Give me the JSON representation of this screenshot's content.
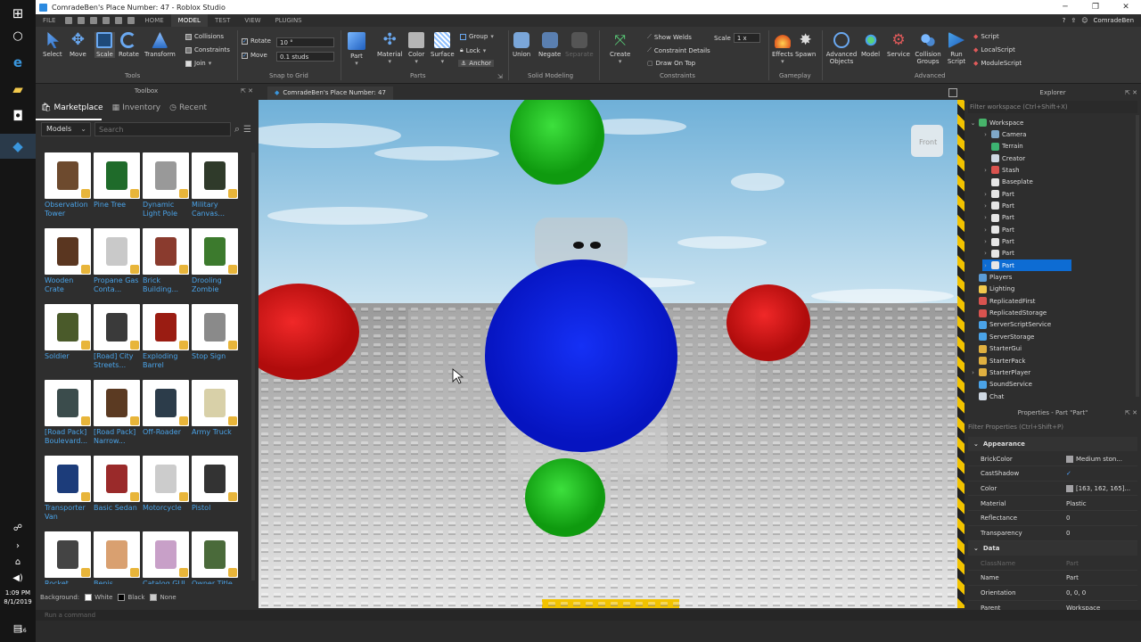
{
  "window": {
    "title": "ComradeBen's Place Number: 47 - Roblox Studio"
  },
  "menu": {
    "file": "FILE",
    "tabs": [
      "HOME",
      "MODEL",
      "TEST",
      "VIEW",
      "PLUGINS"
    ],
    "active_tab": "MODEL",
    "username": "ComradeBen"
  },
  "ribbon": {
    "tools": {
      "select": "Select",
      "move": "Move",
      "scale": "Scale",
      "rotate": "Rotate",
      "transform": "Transform",
      "group_label": "Tools"
    },
    "options": {
      "collisions": "Collisions",
      "constraints": "Constraints",
      "join": "Join"
    },
    "snap": {
      "rotate_label": "Rotate",
      "rotate_value": "10 °",
      "move_label": "Move",
      "move_value": "0.1 studs",
      "group_label": "Snap to Grid"
    },
    "parts": {
      "part": "Part",
      "material": "Material",
      "color": "Color",
      "surface": "Surface",
      "group": "Group",
      "lock": "Lock",
      "anchor": "Anchor",
      "group_label": "Parts"
    },
    "solid": {
      "union": "Union",
      "negate": "Negate",
      "separate": "Separate",
      "group_label": "Solid Modeling"
    },
    "constraints": {
      "create": "Create",
      "show_welds": "Show Welds",
      "details": "Constraint Details",
      "draw_on_top": "Draw On Top",
      "scale_label": "Scale",
      "scale_value": "1 x",
      "group_label": "Constraints"
    },
    "gameplay": {
      "effects": "Effects",
      "spawn": "Spawn",
      "group_label": "Gameplay"
    },
    "advanced": {
      "advanced_objects": "Advanced Objects",
      "model": "Model",
      "service": "Service",
      "collision_groups": "Collision Groups",
      "run_script": "Run Script",
      "script": "Script",
      "local_script": "LocalScript",
      "module_script": "ModuleScript",
      "group_label": "Advanced"
    }
  },
  "toolbox": {
    "title": "Toolbox",
    "tabs": [
      "Marketplace",
      "Inventory",
      "Recent"
    ],
    "category": "Models",
    "search_placeholder": "Search",
    "items": [
      {
        "label": "Observation Tower",
        "color": "#6d4a2e"
      },
      {
        "label": "Pine Tree",
        "color": "#1f6b2a"
      },
      {
        "label": "Dynamic Light Pole",
        "color": "#999999"
      },
      {
        "label": "Military Canvas...",
        "color": "#2f3a2a"
      },
      {
        "label": "Wooden Crate",
        "color": "#5a3620"
      },
      {
        "label": "Propane Gas Conta...",
        "color": "#c9c9c9"
      },
      {
        "label": "Brick Building...",
        "color": "#8a3b2e"
      },
      {
        "label": "Drooling Zombie",
        "color": "#3c7a2d"
      },
      {
        "label": "Soldier",
        "color": "#4a5a2a"
      },
      {
        "label": "[Road] City Streets...",
        "color": "#3a3a3a"
      },
      {
        "label": "Exploding Barrel",
        "color": "#9a1c12"
      },
      {
        "label": "Stop Sign",
        "color": "#8a8a8a"
      },
      {
        "label": "[Road Pack] Boulevard...",
        "color": "#3b4c4c"
      },
      {
        "label": "[Road Pack] Narrow...",
        "color": "#5b3a22"
      },
      {
        "label": "Off-Roader",
        "color": "#2c3c4a"
      },
      {
        "label": "Army Truck",
        "color": "#d8d0a8"
      },
      {
        "label": "Transporter Van",
        "color": "#1c3c7a"
      },
      {
        "label": "Basic Sedan",
        "color": "#9a2a2a"
      },
      {
        "label": "Motorcycle",
        "color": "#cccccc"
      },
      {
        "label": "Pistol",
        "color": "#333333"
      },
      {
        "label": "Rocket",
        "color": "#444444"
      },
      {
        "label": "Bepis",
        "color": "#d9a070"
      },
      {
        "label": "Catalog GUI",
        "color": "#c8a0c8"
      },
      {
        "label": "Owner Title",
        "color": "#4a6a3a"
      }
    ],
    "background_label": "Background:",
    "bg_options": [
      "White",
      "Black",
      "None"
    ]
  },
  "viewport": {
    "tab_title": "ComradeBen's Place Number: 47",
    "view_cube_label": "Front"
  },
  "explorer": {
    "title": "Explorer",
    "filter_placeholder": "Filter workspace (Ctrl+Shift+X)",
    "tree": [
      {
        "label": "Workspace",
        "depth": 0,
        "arrow": "⌄",
        "icon": "#47b36a"
      },
      {
        "label": "Camera",
        "depth": 1,
        "arrow": "›",
        "icon": "#7fa8c9"
      },
      {
        "label": "Terrain",
        "depth": 1,
        "arrow": "",
        "icon": "#3cb371"
      },
      {
        "label": "Creator",
        "depth": 1,
        "arrow": "",
        "icon": "#cfd8e3"
      },
      {
        "label": "Stash",
        "depth": 1,
        "arrow": "›",
        "icon": "#d9534f"
      },
      {
        "label": "Baseplate",
        "depth": 1,
        "arrow": "",
        "icon": "#e6e6e6"
      },
      {
        "label": "Part",
        "depth": 1,
        "arrow": "›",
        "icon": "#e6e6e6"
      },
      {
        "label": "Part",
        "depth": 1,
        "arrow": "›",
        "icon": "#e6e6e6"
      },
      {
        "label": "Part",
        "depth": 1,
        "arrow": "›",
        "icon": "#e6e6e6"
      },
      {
        "label": "Part",
        "depth": 1,
        "arrow": "›",
        "icon": "#e6e6e6"
      },
      {
        "label": "Part",
        "depth": 1,
        "arrow": "›",
        "icon": "#e6e6e6"
      },
      {
        "label": "Part",
        "depth": 1,
        "arrow": "›",
        "icon": "#e6e6e6"
      },
      {
        "label": "Part",
        "depth": 1,
        "arrow": "›",
        "icon": "#e6e6e6",
        "selected": true
      },
      {
        "label": "Players",
        "depth": 0,
        "arrow": "",
        "icon": "#5b9bd5"
      },
      {
        "label": "Lighting",
        "depth": 0,
        "arrow": "",
        "icon": "#f2c94c"
      },
      {
        "label": "ReplicatedFirst",
        "depth": 0,
        "arrow": "",
        "icon": "#d9534f"
      },
      {
        "label": "ReplicatedStorage",
        "depth": 0,
        "arrow": "",
        "icon": "#d9534f"
      },
      {
        "label": "ServerScriptService",
        "depth": 0,
        "arrow": "",
        "icon": "#4aa3e8"
      },
      {
        "label": "ServerStorage",
        "depth": 0,
        "arrow": "",
        "icon": "#4aa3e8"
      },
      {
        "label": "StarterGui",
        "depth": 0,
        "arrow": "",
        "icon": "#e0b040"
      },
      {
        "label": "StarterPack",
        "depth": 0,
        "arrow": "",
        "icon": "#e0b040"
      },
      {
        "label": "StarterPlayer",
        "depth": 0,
        "arrow": "›",
        "icon": "#e0b040"
      },
      {
        "label": "SoundService",
        "depth": 0,
        "arrow": "",
        "icon": "#4aa3e8"
      },
      {
        "label": "Chat",
        "depth": 0,
        "arrow": "",
        "icon": "#cfd8e3"
      }
    ]
  },
  "properties": {
    "title": "Properties - Part \"Part\"",
    "filter_placeholder": "Filter Properties (Ctrl+Shift+P)",
    "appearance_label": "Appearance",
    "data_label": "Data",
    "appearance": [
      {
        "key": "BrickColor",
        "value": "Medium ston...",
        "swatch": "#a3a2a5"
      },
      {
        "key": "CastShadow",
        "value": "✓",
        "swatch": ""
      },
      {
        "key": "Color",
        "value": "[163, 162, 165]...",
        "swatch": "#a3a2a5"
      },
      {
        "key": "Material",
        "value": "Plastic",
        "swatch": ""
      },
      {
        "key": "Reflectance",
        "value": "0",
        "swatch": ""
      },
      {
        "key": "Transparency",
        "value": "0",
        "swatch": ""
      }
    ],
    "data": [
      {
        "key": "ClassName",
        "value": "Part",
        "dim": true
      },
      {
        "key": "Name",
        "value": "Part",
        "dim": false
      },
      {
        "key": "Orientation",
        "value": "0, 0, 0",
        "dim": false
      },
      {
        "key": "Parent",
        "value": "Workspace",
        "dim": false
      }
    ]
  },
  "command_bar": {
    "placeholder": "Run a command"
  },
  "system": {
    "time": "1:09 PM",
    "date": "8/1/2019",
    "notif_count": "16"
  },
  "colors": {
    "accent": "#0d6cd3",
    "link": "#4aa3e8",
    "sphere_green": "#1fbf1f",
    "sphere_red": "#e01515",
    "sphere_blue": "#0a1ee0"
  }
}
